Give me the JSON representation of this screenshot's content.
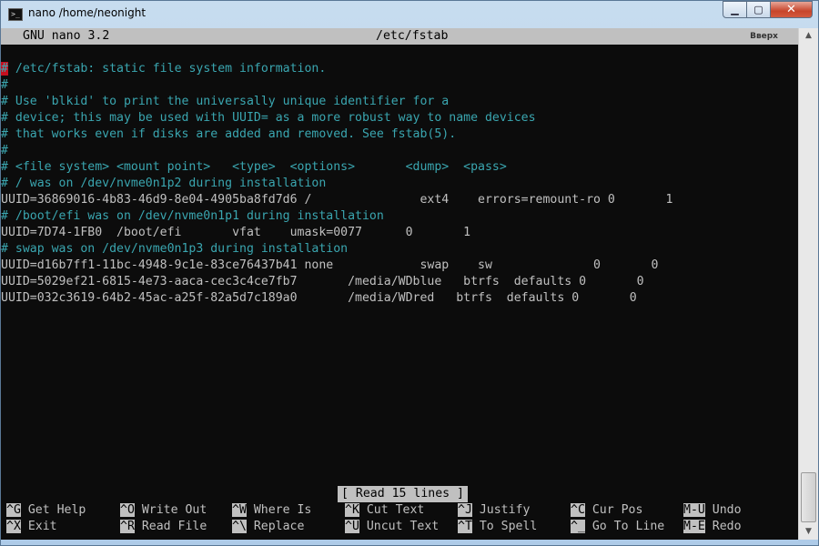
{
  "window": {
    "title": "nano /home/neonight",
    "icon": "terminal-icon",
    "icon_glyph": ">_",
    "controls": {
      "minimize": "▁",
      "maximize": "▢",
      "close": "✕"
    }
  },
  "nano": {
    "version": "GNU nano 3.2",
    "filename": "/etc/fstab",
    "corner_badge": "Вверх",
    "cursor_char": "#",
    "lines": [
      {
        "text": " /etc/fstab: static file system information.",
        "type": "comment"
      },
      {
        "text": "#",
        "type": "comment"
      },
      {
        "text": "# Use 'blkid' to print the universally unique identifier for a",
        "type": "comment"
      },
      {
        "text": "# device; this may be used with UUID= as a more robust way to name devices",
        "type": "comment"
      },
      {
        "text": "# that works even if disks are added and removed. See fstab(5).",
        "type": "comment"
      },
      {
        "text": "#",
        "type": "comment"
      },
      {
        "text": "# <file system> <mount point>   <type>  <options>       <dump>  <pass>",
        "type": "comment"
      },
      {
        "text": "# / was on /dev/nvme0n1p2 during installation",
        "type": "comment"
      },
      {
        "text": "UUID=36869016-4b83-46d9-8e04-4905ba8fd7d6 /               ext4    errors=remount-ro 0       1",
        "type": "text"
      },
      {
        "text": "# /boot/efi was on /dev/nvme0n1p1 during installation",
        "type": "comment"
      },
      {
        "text": "UUID=7D74-1FB0  /boot/efi       vfat    umask=0077      0       1",
        "type": "text"
      },
      {
        "text": "# swap was on /dev/nvme0n1p3 during installation",
        "type": "comment"
      },
      {
        "text": "UUID=d16b7ff1-11bc-4948-9c1e-83ce76437b41 none            swap    sw              0       0",
        "type": "text"
      },
      {
        "text": "UUID=5029ef21-6815-4e73-aaca-cec3c4ce7fb7       /media/WDblue   btrfs  defaults 0       0",
        "type": "text"
      },
      {
        "text": "UUID=032c3619-64b2-45ac-a25f-82a5d7c189a0       /media/WDred   btrfs  defaults 0       0",
        "type": "text"
      }
    ],
    "status": "[ Read 15 lines ]",
    "shortcuts_row1": [
      {
        "key": "^G",
        "label": " Get Help"
      },
      {
        "key": "^O",
        "label": " Write Out"
      },
      {
        "key": "^W",
        "label": " Where Is"
      },
      {
        "key": "^K",
        "label": " Cut Text"
      },
      {
        "key": "^J",
        "label": " Justify"
      },
      {
        "key": "^C",
        "label": " Cur Pos"
      },
      {
        "key": "M-U",
        "label": " Undo"
      }
    ],
    "shortcuts_row2": [
      {
        "key": "^X",
        "label": " Exit"
      },
      {
        "key": "^R",
        "label": " Read File"
      },
      {
        "key": "^\\",
        "label": " Replace"
      },
      {
        "key": "^U",
        "label": " Uncut Text"
      },
      {
        "key": "^T",
        "label": " To Spell"
      },
      {
        "key": "^_",
        "label": " Go To Line"
      },
      {
        "key": "M-E",
        "label": " Redo"
      }
    ]
  },
  "scrollbar": {
    "up": "▲",
    "down": "▼"
  },
  "colors": {
    "comment": "#3aa6b0",
    "text": "#c0c0c0",
    "background": "#0c0c0c",
    "cursor": "#c50f1f"
  }
}
